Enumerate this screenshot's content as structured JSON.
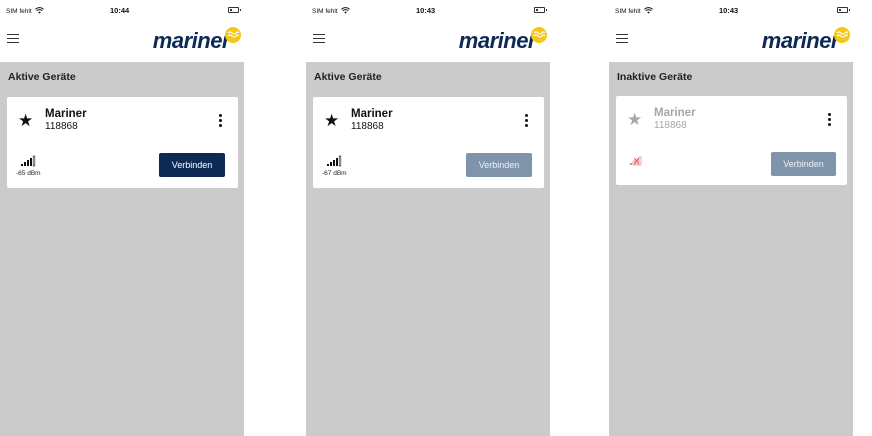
{
  "screens": [
    {
      "status": {
        "carrier": "SIM fehlt",
        "time": "10:44"
      },
      "brand": "mariner",
      "section_title": "Aktive Geräte",
      "device": {
        "name": "Mariner",
        "id": "118868",
        "rssi": "-65 dBm",
        "signal": "good"
      },
      "connect": {
        "label": "Verbinden",
        "state": "enabled"
      }
    },
    {
      "status": {
        "carrier": "SIM fehlt",
        "time": "10:43"
      },
      "brand": "mariner",
      "section_title": "Aktive Geräte",
      "device": {
        "name": "Mariner",
        "id": "118868",
        "rssi": "-67 dBm",
        "signal": "good"
      },
      "connect": {
        "label": "Verbinden",
        "state": "disabled"
      }
    },
    {
      "status": {
        "carrier": "SIM fehlt",
        "time": "10:43"
      },
      "brand": "mariner",
      "section_title": "Inaktive Geräte",
      "device": {
        "name": "Mariner",
        "id": "118868",
        "rssi": "",
        "signal": "none"
      },
      "connect": {
        "label": "Verbinden",
        "state": "disabled"
      }
    }
  ],
  "colors": {
    "brand_navy": "#0d2a55",
    "button_disabled": "#7f93ab",
    "sun_yellow": "#f5c518",
    "background_gray": "#cbcbcb",
    "no_signal_red": "#e05555"
  },
  "icons": [
    "wifi-icon",
    "battery-icon",
    "menu-icon",
    "sun-logo-icon",
    "star-icon",
    "kebab-menu-icon",
    "signal-strength-icon",
    "no-signal-icon"
  ]
}
